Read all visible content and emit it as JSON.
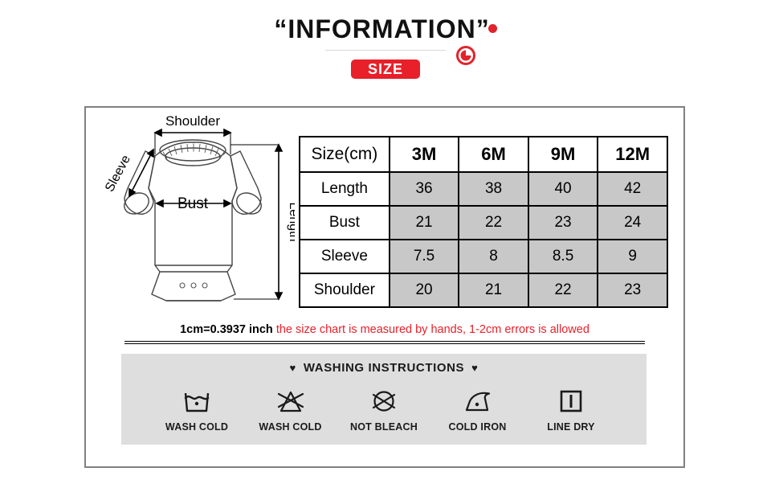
{
  "header": {
    "title_quote_open": "“",
    "title": "INFORMATION",
    "title_quote_close": "”",
    "badge_label": "SIZE",
    "accent_color": "#E8202A",
    "decoration_icon": "red-circle-icon"
  },
  "diagram": {
    "name": "baby-romper-measurement-diagram",
    "labels": {
      "shoulder": "Shoulder",
      "sleeve": "Sleeve",
      "bust": "Bust",
      "length": "Length"
    }
  },
  "table": {
    "headers": [
      "Size(cm)",
      "3M",
      "6M",
      "9M",
      "12M"
    ],
    "rows": [
      {
        "label": "Length",
        "values": [
          "36",
          "38",
          "40",
          "42"
        ]
      },
      {
        "label": "Bust",
        "values": [
          "21",
          "22",
          "23",
          "24"
        ]
      },
      {
        "label": "Sleeve",
        "values": [
          "7.5",
          "8",
          "8.5",
          "9"
        ]
      },
      {
        "label": "Shoulder",
        "values": [
          "20",
          "21",
          "22",
          "23"
        ]
      }
    ],
    "value_cell_color": "#c8c8c8",
    "border_color": "#000000"
  },
  "note": {
    "conversion": "1cm=0.3937 inch",
    "disclaimer": "the size chart is measured by hands, 1-2cm errors is allowed",
    "disclaimer_color": "#E8202A"
  },
  "washing": {
    "heart_left": "♥",
    "title": "WASHING INSTRUCTIONS",
    "heart_right": "♥",
    "background_color": "#dedede",
    "items": [
      {
        "icon": "wash-tub-one-dot-icon",
        "label": "WASH COLD"
      },
      {
        "icon": "triangle-crossed-no-bleach-icon",
        "label": "WASH COLD"
      },
      {
        "icon": "circle-crossed-not-bleach-icon",
        "label": "NOT BLEACH"
      },
      {
        "icon": "iron-one-dot-icon",
        "label": "COLD IRON"
      },
      {
        "icon": "square-vertical-bar-line-dry-icon",
        "label": "LINE DRY"
      }
    ]
  }
}
